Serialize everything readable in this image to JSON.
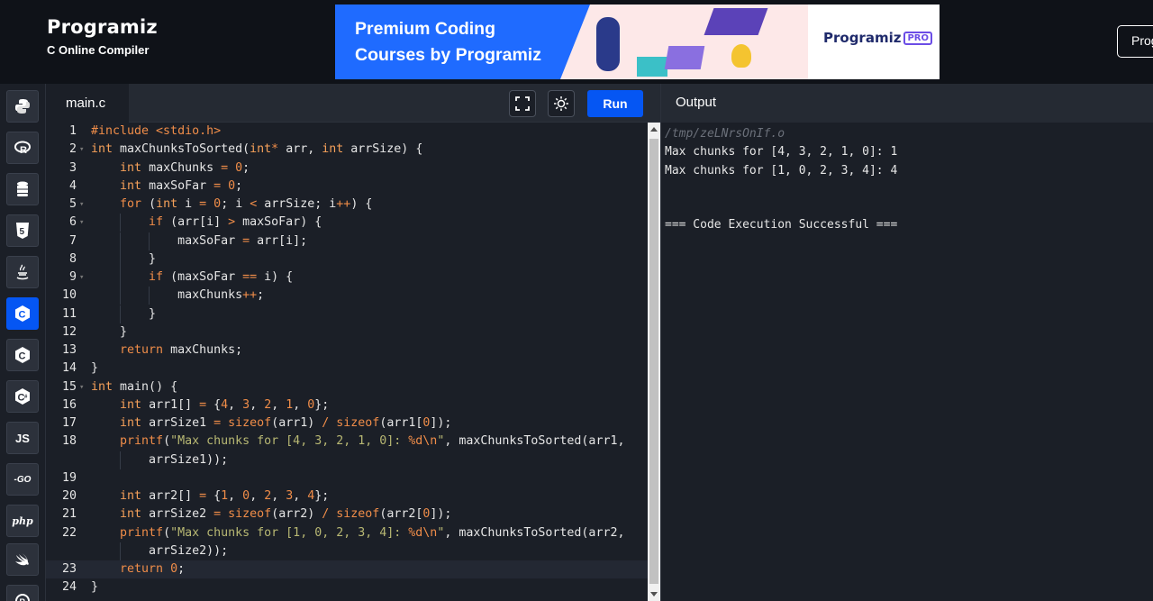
{
  "header": {
    "logo": "Programiz",
    "subtitle": "C Online Compiler",
    "ad_line1": "Premium Coding",
    "ad_line2": "Courses by Programiz",
    "ad_logo": "Programiz",
    "ad_pro": "PRO",
    "right_button": "Prog"
  },
  "sidebar": {
    "items": [
      {
        "name": "python-icon",
        "label": ""
      },
      {
        "name": "r-icon",
        "label": ""
      },
      {
        "name": "database-icon",
        "label": ""
      },
      {
        "name": "html5-icon",
        "label": "5"
      },
      {
        "name": "java-icon",
        "label": ""
      },
      {
        "name": "c-icon",
        "label": "C",
        "active": true
      },
      {
        "name": "cpp-icon",
        "label": "C"
      },
      {
        "name": "csharp-icon",
        "label": "C"
      },
      {
        "name": "javascript-icon",
        "label": "JS"
      },
      {
        "name": "go-icon",
        "label": "-GO"
      },
      {
        "name": "php-icon",
        "label": "php"
      },
      {
        "name": "swift-icon",
        "label": ""
      },
      {
        "name": "rust-icon",
        "label": ""
      }
    ]
  },
  "editor": {
    "tab_label": "main.c",
    "run_label": "Run",
    "fullscreen_icon": "fullscreen-icon",
    "theme_icon": "sun-icon",
    "active_line": 23,
    "lines": [
      {
        "n": "1",
        "tokens": [
          [
            "pp",
            "#include <stdio.h>"
          ]
        ]
      },
      {
        "n": "2",
        "fold": true,
        "tokens": [
          [
            "ty",
            "int"
          ],
          [
            "t",
            " maxChunksToSorted("
          ],
          [
            "ty",
            "int"
          ],
          [
            "op",
            "*"
          ],
          [
            "t",
            " arr, "
          ],
          [
            "ty",
            "int"
          ],
          [
            "t",
            " arrSize) {"
          ]
        ]
      },
      {
        "n": "3",
        "tokens": [
          [
            "t",
            "    "
          ],
          [
            "ty",
            "int"
          ],
          [
            "t",
            " maxChunks "
          ],
          [
            "op",
            "="
          ],
          [
            "t",
            " "
          ],
          [
            "num",
            "0"
          ],
          [
            "t",
            ";"
          ]
        ]
      },
      {
        "n": "4",
        "tokens": [
          [
            "t",
            "    "
          ],
          [
            "ty",
            "int"
          ],
          [
            "t",
            " maxSoFar "
          ],
          [
            "op",
            "="
          ],
          [
            "t",
            " "
          ],
          [
            "num",
            "0"
          ],
          [
            "t",
            ";"
          ]
        ]
      },
      {
        "n": "5",
        "fold": true,
        "tokens": [
          [
            "t",
            "    "
          ],
          [
            "kw",
            "for"
          ],
          [
            "t",
            " ("
          ],
          [
            "ty",
            "int"
          ],
          [
            "t",
            " i "
          ],
          [
            "op",
            "="
          ],
          [
            "t",
            " "
          ],
          [
            "num",
            "0"
          ],
          [
            "t",
            "; i "
          ],
          [
            "op",
            "<"
          ],
          [
            "t",
            " arrSize; i"
          ],
          [
            "op",
            "++"
          ],
          [
            "t",
            ") {"
          ]
        ]
      },
      {
        "n": "6",
        "fold": true,
        "tokens": [
          [
            "t",
            "        "
          ],
          [
            "kw",
            "if"
          ],
          [
            "t",
            " (arr[i] "
          ],
          [
            "op",
            ">"
          ],
          [
            "t",
            " maxSoFar) {"
          ]
        ]
      },
      {
        "n": "7",
        "tokens": [
          [
            "t",
            "            maxSoFar "
          ],
          [
            "op",
            "="
          ],
          [
            "t",
            " arr[i];"
          ]
        ]
      },
      {
        "n": "8",
        "tokens": [
          [
            "t",
            "        }"
          ]
        ]
      },
      {
        "n": "9",
        "fold": true,
        "tokens": [
          [
            "t",
            "        "
          ],
          [
            "kw",
            "if"
          ],
          [
            "t",
            " (maxSoFar "
          ],
          [
            "op",
            "=="
          ],
          [
            "t",
            " i) {"
          ]
        ]
      },
      {
        "n": "10",
        "tokens": [
          [
            "t",
            "            maxChunks"
          ],
          [
            "op",
            "++"
          ],
          [
            "t",
            ";"
          ]
        ]
      },
      {
        "n": "11",
        "tokens": [
          [
            "t",
            "        }"
          ]
        ]
      },
      {
        "n": "12",
        "tokens": [
          [
            "t",
            "    }"
          ]
        ]
      },
      {
        "n": "13",
        "tokens": [
          [
            "t",
            "    "
          ],
          [
            "kw",
            "return"
          ],
          [
            "t",
            " maxChunks;"
          ]
        ]
      },
      {
        "n": "14",
        "tokens": [
          [
            "t",
            "}"
          ]
        ]
      },
      {
        "n": "15",
        "fold": true,
        "tokens": [
          [
            "ty",
            "int"
          ],
          [
            "t",
            " main() {"
          ]
        ]
      },
      {
        "n": "16",
        "tokens": [
          [
            "t",
            "    "
          ],
          [
            "ty",
            "int"
          ],
          [
            "t",
            " arr1[] "
          ],
          [
            "op",
            "="
          ],
          [
            "t",
            " {"
          ],
          [
            "num",
            "4"
          ],
          [
            "t",
            ", "
          ],
          [
            "num",
            "3"
          ],
          [
            "t",
            ", "
          ],
          [
            "num",
            "2"
          ],
          [
            "t",
            ", "
          ],
          [
            "num",
            "1"
          ],
          [
            "t",
            ", "
          ],
          [
            "num",
            "0"
          ],
          [
            "t",
            "};"
          ]
        ]
      },
      {
        "n": "17",
        "tokens": [
          [
            "t",
            "    "
          ],
          [
            "ty",
            "int"
          ],
          [
            "t",
            " arrSize1 "
          ],
          [
            "op",
            "="
          ],
          [
            "t",
            " "
          ],
          [
            "kw",
            "sizeof"
          ],
          [
            "t",
            "(arr1) "
          ],
          [
            "op",
            "/"
          ],
          [
            "t",
            " "
          ],
          [
            "kw",
            "sizeof"
          ],
          [
            "t",
            "(arr1["
          ],
          [
            "num",
            "0"
          ],
          [
            "t",
            "]);"
          ]
        ]
      },
      {
        "n": "18",
        "tokens": [
          [
            "t",
            "    "
          ],
          [
            "kw",
            "printf"
          ],
          [
            "t",
            "("
          ],
          [
            "str",
            "\"Max chunks for [4, 3, 2, 1, 0]: "
          ],
          [
            "op",
            "%d\\n"
          ],
          [
            "str",
            "\""
          ],
          [
            "t",
            ", maxChunksToSorted(arr1,"
          ]
        ]
      },
      {
        "n": "",
        "tokens": [
          [
            "t",
            "        arrSize1));"
          ]
        ]
      },
      {
        "n": "19",
        "tokens": [
          [
            "t",
            ""
          ]
        ]
      },
      {
        "n": "20",
        "tokens": [
          [
            "t",
            "    "
          ],
          [
            "ty",
            "int"
          ],
          [
            "t",
            " arr2[] "
          ],
          [
            "op",
            "="
          ],
          [
            "t",
            " {"
          ],
          [
            "num",
            "1"
          ],
          [
            "t",
            ", "
          ],
          [
            "num",
            "0"
          ],
          [
            "t",
            ", "
          ],
          [
            "num",
            "2"
          ],
          [
            "t",
            ", "
          ],
          [
            "num",
            "3"
          ],
          [
            "t",
            ", "
          ],
          [
            "num",
            "4"
          ],
          [
            "t",
            "};"
          ]
        ]
      },
      {
        "n": "21",
        "tokens": [
          [
            "t",
            "    "
          ],
          [
            "ty",
            "int"
          ],
          [
            "t",
            " arrSize2 "
          ],
          [
            "op",
            "="
          ],
          [
            "t",
            " "
          ],
          [
            "kw",
            "sizeof"
          ],
          [
            "t",
            "(arr2) "
          ],
          [
            "op",
            "/"
          ],
          [
            "t",
            " "
          ],
          [
            "kw",
            "sizeof"
          ],
          [
            "t",
            "(arr2["
          ],
          [
            "num",
            "0"
          ],
          [
            "t",
            "]);"
          ]
        ]
      },
      {
        "n": "22",
        "tokens": [
          [
            "t",
            "    "
          ],
          [
            "kw",
            "printf"
          ],
          [
            "t",
            "("
          ],
          [
            "str",
            "\"Max chunks for [1, 0, 2, 3, 4]: "
          ],
          [
            "op",
            "%d\\n"
          ],
          [
            "str",
            "\""
          ],
          [
            "t",
            ", maxChunksToSorted(arr2,"
          ]
        ]
      },
      {
        "n": "",
        "tokens": [
          [
            "t",
            "        arrSize2));"
          ]
        ]
      },
      {
        "n": "23",
        "tokens": [
          [
            "t",
            "    "
          ],
          [
            "kw",
            "return"
          ],
          [
            "t",
            " "
          ],
          [
            "num",
            "0"
          ],
          [
            "t",
            ";"
          ]
        ]
      },
      {
        "n": "24",
        "tokens": [
          [
            "t",
            "}"
          ]
        ]
      }
    ]
  },
  "output": {
    "title": "Output",
    "path": "/tmp/zeLNrsOnIf.o",
    "lines": [
      "Max chunks for [4, 3, 2, 1, 0]: 1",
      "Max chunks for [1, 0, 2, 3, 4]: 4",
      "",
      "",
      "=== Code Execution Successful ==="
    ]
  }
}
